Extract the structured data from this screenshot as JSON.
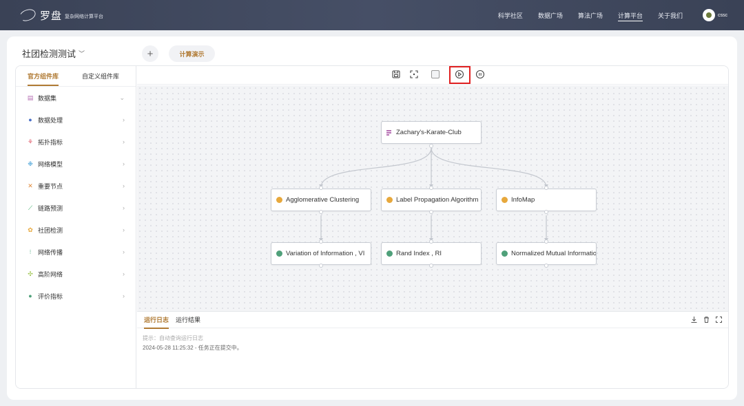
{
  "header": {
    "brand_name": "罗盘",
    "brand_sub": "复杂网络计算平台",
    "nav": [
      {
        "label": "科学社区"
      },
      {
        "label": "数据广场"
      },
      {
        "label": "算法广场"
      },
      {
        "label": "计算平台",
        "active": true
      },
      {
        "label": "关于我们"
      }
    ],
    "user": "cssc"
  },
  "project": {
    "title": "社团检测测试",
    "add_label": "+",
    "tab_label": "计算演示"
  },
  "sidebar": {
    "tabs": [
      "官方组件库",
      "自定义组件库"
    ],
    "categories": [
      {
        "label": "数据集",
        "icon": "dataset-icon",
        "arrow": "⌄"
      },
      {
        "label": "数据处理",
        "icon": "data-processing-icon",
        "arrow": "›"
      },
      {
        "label": "拓扑指标",
        "icon": "topology-icon",
        "arrow": "›"
      },
      {
        "label": "网络模型",
        "icon": "network-model-icon",
        "arrow": "›"
      },
      {
        "label": "重要节点",
        "icon": "important-node-icon",
        "arrow": "›"
      },
      {
        "label": "链路预测",
        "icon": "link-prediction-icon",
        "arrow": "›"
      },
      {
        "label": "社团检测",
        "icon": "community-detection-icon",
        "arrow": "›"
      },
      {
        "label": "网络传播",
        "icon": "network-spread-icon",
        "arrow": "›"
      },
      {
        "label": "高阶网络",
        "icon": "higher-order-icon",
        "arrow": "›"
      },
      {
        "label": "评价指标",
        "icon": "evaluation-icon",
        "arrow": "›"
      }
    ]
  },
  "toolbar": {
    "icons": [
      "save-icon",
      "fit-view-icon",
      "select-box-icon",
      "run-icon",
      "pause-icon"
    ]
  },
  "flow": {
    "nodes": {
      "dataset": {
        "label": "Zachary's-Karate-Club"
      },
      "agglomerative": {
        "label": "Agglomerative Clustering"
      },
      "label_propagation": {
        "label": "Label Propagation Algorithm"
      },
      "infomap": {
        "label": "InfoMap"
      },
      "vi": {
        "label": "Variation of Information , VI"
      },
      "ri": {
        "label": "Rand Index , RI"
      },
      "nmi": {
        "label": "Normalized Mutual Information"
      }
    }
  },
  "log": {
    "tabs": [
      "运行日志",
      "运行结果"
    ],
    "hint": "提示：自动查询运行日志",
    "lines": [
      "2024-05-28 11:25:32 - 任务正在提交中。"
    ]
  },
  "colors": {
    "accent": "#b07a33",
    "header_bg": "#3a4256",
    "highlight": "#e02020"
  }
}
